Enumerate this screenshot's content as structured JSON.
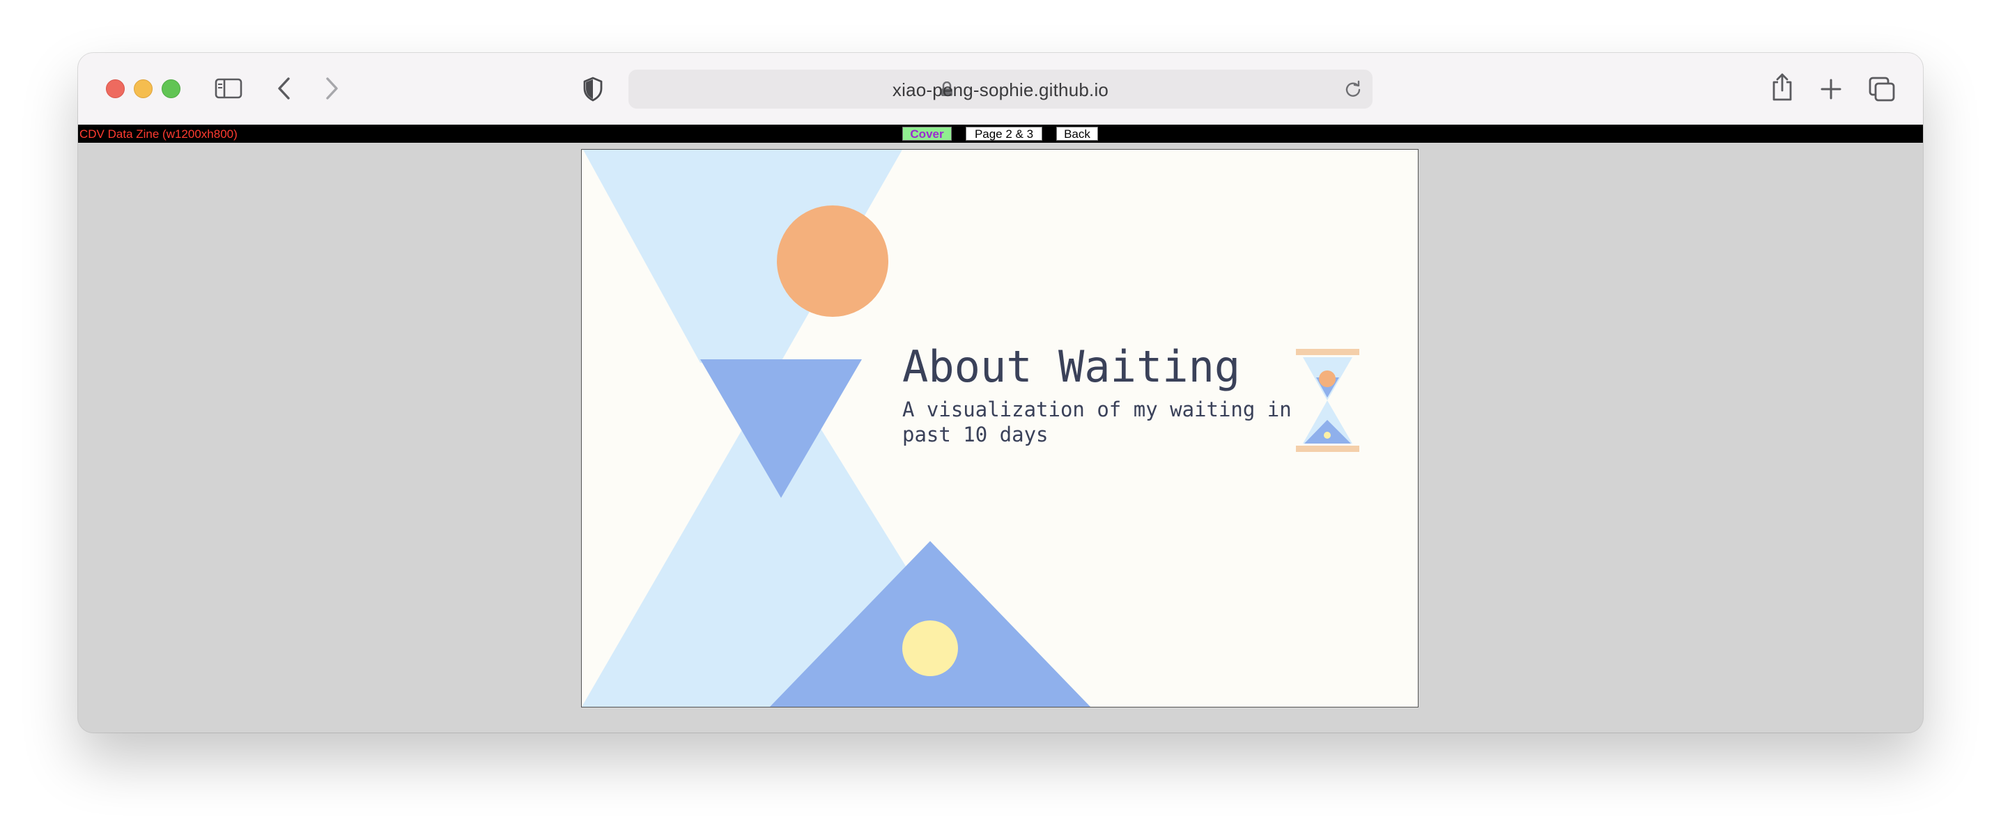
{
  "browser": {
    "url": "xiao-peng-sophie.github.io",
    "icons": [
      "sidebar-icon",
      "back-arrow-icon",
      "forward-arrow-icon",
      "shield-icon",
      "lock-icon",
      "reload-icon",
      "share-icon",
      "new-tab-icon",
      "tabs-overview-icon"
    ]
  },
  "zine": {
    "label": "CDV Data Zine (w1200xh800)",
    "nav": {
      "cover": "Cover",
      "pages": "Page 2 & 3",
      "back": "Back"
    }
  },
  "cover": {
    "title": "About Waiting",
    "subtitle": "A visualization of my waiting in past 10 days"
  },
  "colors": {
    "page_background": "#fdfcf7",
    "light_blue": "#d5ebfb",
    "blue": "#8fb0ec",
    "orange": "#f4b07c",
    "yellow": "#fdf0a6",
    "peach": "#f4cfaa",
    "text": "#3a4159",
    "cover_button": "#90ee90"
  }
}
